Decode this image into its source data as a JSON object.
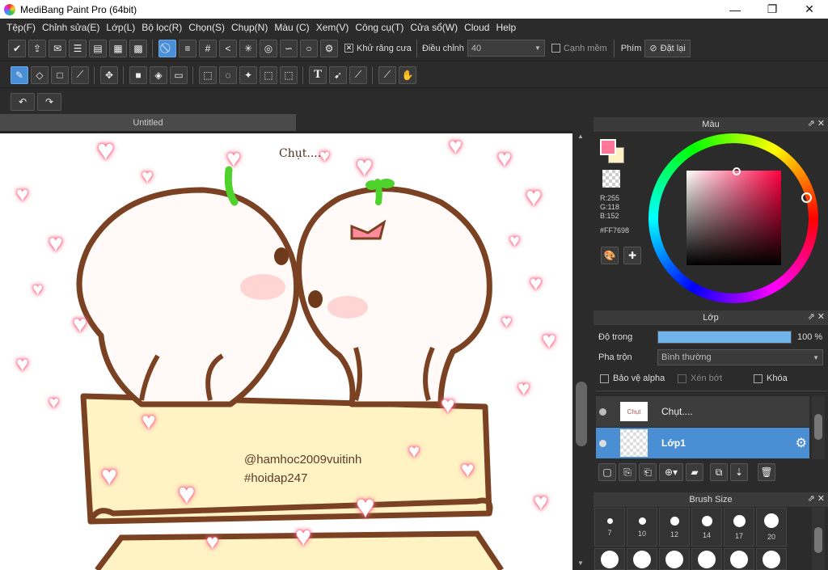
{
  "window": {
    "title": "MediBang Paint Pro (64bit)",
    "min": "—",
    "max": "❐",
    "close": "✕"
  },
  "menu": [
    "Tệp(F)",
    "Chỉnh sửa(E)",
    "Lớp(L)",
    "Bộ lọc(R)",
    "Chọn(S)",
    "Chụp(N)",
    "Màu (C)",
    "Xem(V)",
    "Công cụ(T)",
    "Cửa sổ(W)",
    "Cloud",
    "Help"
  ],
  "toolbar1": {
    "antialias_label": "Khử răng cưa",
    "adjust_label": "Điều chỉnh",
    "adjust_value": "40",
    "soft_edge_label": "Cạnh mềm",
    "key_label": "Phím",
    "reset_label": "Đặt lại"
  },
  "document": {
    "tab": "Untitled"
  },
  "canvas_text": {
    "title": "Chụt....",
    "line1": "@hamhoc2009vuitinh",
    "line2": "#hoidap247"
  },
  "color_panel": {
    "title": "Màu",
    "r": "R:255",
    "g": "G:118",
    "b": "B:152",
    "hex": "#FF7698",
    "fg_color": "#ff7698",
    "bg_color": "#fff3c4"
  },
  "layer_panel": {
    "title": "Lớp",
    "opacity_label": "Độ trong",
    "opacity_value": "100 %",
    "opacity_fraction": 1.0,
    "blend_label": "Pha trộn",
    "blend_value": "Bình thường",
    "protect_alpha": "Bảo vệ alpha",
    "clip": "Xén bớt",
    "lock": "Khóa",
    "layers": [
      {
        "name": "Chụt....",
        "selected": false
      },
      {
        "name": "Lớp1",
        "selected": true
      }
    ]
  },
  "brush_panel": {
    "title": "Brush Size",
    "sizes": [
      "7",
      "10",
      "12",
      "14",
      "17",
      "20"
    ]
  }
}
